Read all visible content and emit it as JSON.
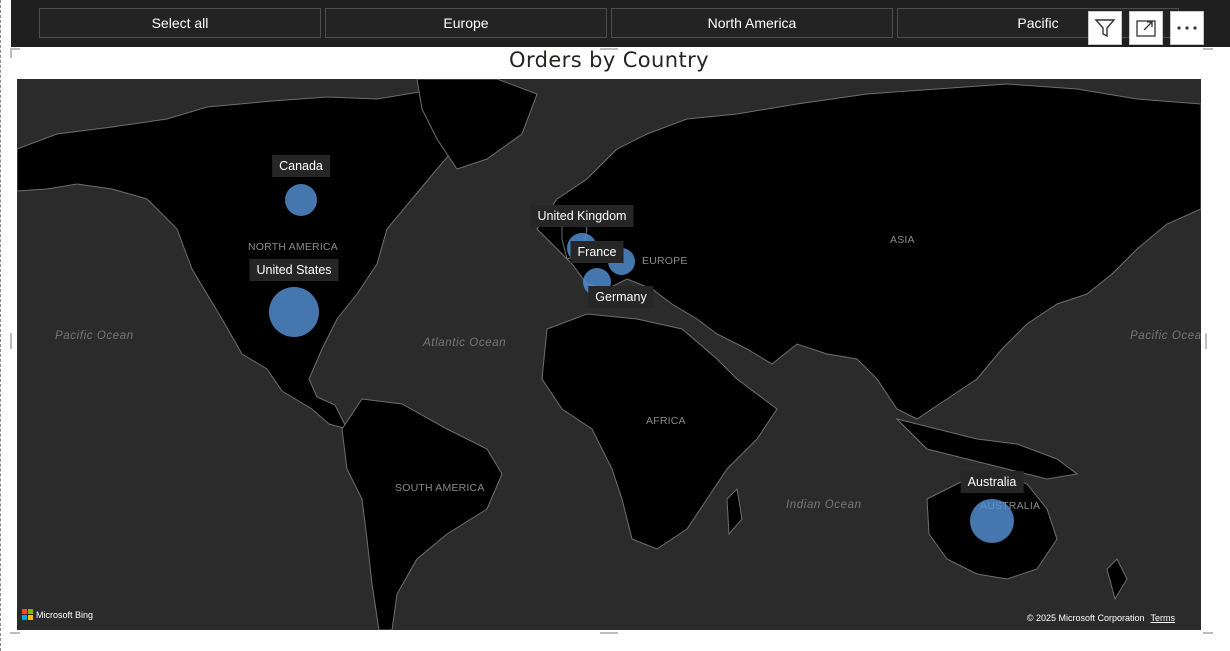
{
  "slicer": {
    "items": [
      {
        "label": "Select all"
      },
      {
        "label": "Europe"
      },
      {
        "label": "North America"
      },
      {
        "label": "Pacific"
      }
    ]
  },
  "visual": {
    "title": "Orders by Country",
    "toolbar": {
      "filter_icon": "filter-icon",
      "focus_icon": "focus-mode-icon",
      "more_icon": "more-options-icon"
    }
  },
  "map": {
    "continent_labels": [
      "NORTH AMERICA",
      "EUROPE",
      "ASIA",
      "AFRICA",
      "SOUTH AMERICA",
      "AUSTRALIA"
    ],
    "ocean_labels": [
      "Pacific Ocean",
      "Atlantic Ocean",
      "Indian Ocean",
      "Pacific Ocea"
    ],
    "countries": [
      {
        "name": "Canada"
      },
      {
        "name": "United States"
      },
      {
        "name": "United Kingdom"
      },
      {
        "name": "France"
      },
      {
        "name": "Germany"
      },
      {
        "name": "Australia"
      }
    ],
    "provider": "Microsoft Bing",
    "copyright": "© 2025 Microsoft Corporation",
    "terms": "Terms",
    "colors": {
      "bubble": "#5491d4",
      "land": "#000000",
      "water": "#2b2b2b"
    }
  }
}
